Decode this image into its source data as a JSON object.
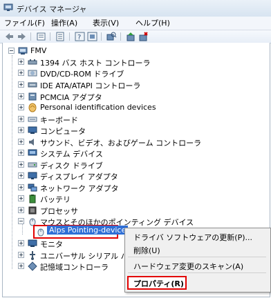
{
  "window": {
    "title": "デバイス マネージャ"
  },
  "menu": [
    "ファイル(F)",
    "操作(A)",
    "表示(V)",
    "ヘルプ(H)"
  ],
  "toolbar": [
    "back-icon",
    "forward-icon",
    "view-icon",
    "properties-icon",
    "help-icon",
    "refresh-icon",
    "update-driver-icon",
    "uninstall-icon"
  ],
  "tree": {
    "root": "FMV",
    "items": [
      "1394 バス ホスト コントローラ",
      "DVD/CD-ROM ドライブ",
      "IDE ATA/ATAPI コントローラ",
      "PCMCIA アダプタ",
      "Personal identification devices",
      "キーボード",
      "コンピュータ",
      "サウンド、ビデオ、およびゲーム コントローラ",
      "システム デバイス",
      "ディスク ドライブ",
      "ディスプレイ アダプタ",
      "ネットワーク アダプタ",
      "バッテリ",
      "プロセッサ",
      "マウスとそのほかのポインティング デバイス"
    ],
    "selected_child": "Alps Pointing-device",
    "after_items": [
      "モニタ",
      "ユニバーサル シリアル バ",
      "記憶域コントローラ"
    ]
  },
  "context_menu": {
    "update_driver": "ドライバ ソフトウェアの更新(P)...",
    "delete": "削除(U)",
    "scan": "ハードウェア変更のスキャン(A)",
    "properties": "プロパティ(R)"
  },
  "colors": {
    "selection": "#2f6fd6",
    "highlight_border": "#e20000"
  }
}
